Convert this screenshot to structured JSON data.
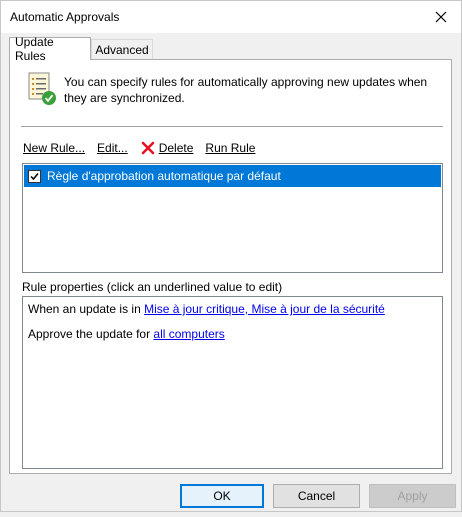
{
  "window": {
    "title": "Automatic Approvals"
  },
  "tabs": [
    {
      "label": "Update Rules",
      "active": true
    },
    {
      "label": "Advanced",
      "active": false
    }
  ],
  "info": {
    "line1": "You can specify rules for automatically approving new updates when",
    "line2": "they are synchronized."
  },
  "toolbar": {
    "new_rule": "New Rule...",
    "edit": "Edit...",
    "delete": "Delete",
    "run_rule": "Run Rule"
  },
  "rules": [
    {
      "label": "Règle d'approbation automatique par défaut",
      "checked": true,
      "selected": true
    }
  ],
  "properties": {
    "label": "Rule properties (click an underlined value to edit)",
    "line1_prefix": "When an update is in ",
    "line1_link": "Mise à jour critique, Mise à jour de la sécurité",
    "line2_prefix": "Approve the update for ",
    "line2_link": "all computers"
  },
  "buttons": {
    "ok": "OK",
    "cancel": "Cancel",
    "apply": "Apply"
  },
  "colors": {
    "selection": "#0078d7",
    "link": "#0000ee",
    "delete_icon": "#e81123"
  }
}
